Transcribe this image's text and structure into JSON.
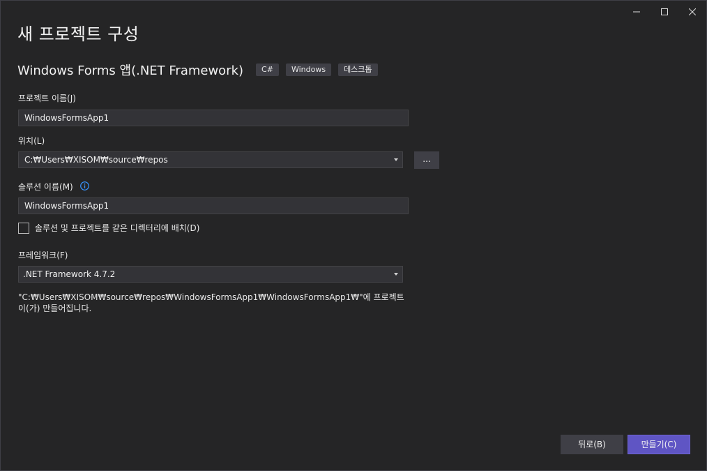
{
  "window": {
    "controls": {
      "minimize_icon": "minimize-icon",
      "maximize_icon": "maximize-icon",
      "close_icon": "close-icon"
    }
  },
  "header": {
    "title": "새 프로젝트 구성"
  },
  "template": {
    "name": "Windows Forms 앱(.NET Framework)",
    "tags": [
      "C#",
      "Windows",
      "데스크톱"
    ]
  },
  "form": {
    "project_name": {
      "label": "프로젝트 이름(J)",
      "value": "WindowsFormsApp1"
    },
    "location": {
      "label": "위치(L)",
      "value": "C:₩Users₩XISOM₩source₩repos",
      "browse_label": "..."
    },
    "solution_name": {
      "label": "솔루션 이름(M)",
      "value": "WindowsFormsApp1",
      "info_icon": "info-icon"
    },
    "same_directory": {
      "label": "솔루션 및 프로젝트를 같은 디렉터리에 배치(D)",
      "checked": false
    },
    "framework": {
      "label": "프레임워크(F)",
      "value": ".NET Framework 4.7.2"
    },
    "path_note": "\"C:₩Users₩XISOM₩source₩repos₩WindowsFormsApp1₩WindowsFormsApp1₩\"에 프로젝트이(가) 만들어집니다."
  },
  "footer": {
    "back_label": "뒤로(B)",
    "create_label": "만들기(C)"
  },
  "colors": {
    "background": "#252526",
    "input_bg": "#333337",
    "accent": "#5f55c4",
    "info": "#3794ff"
  }
}
